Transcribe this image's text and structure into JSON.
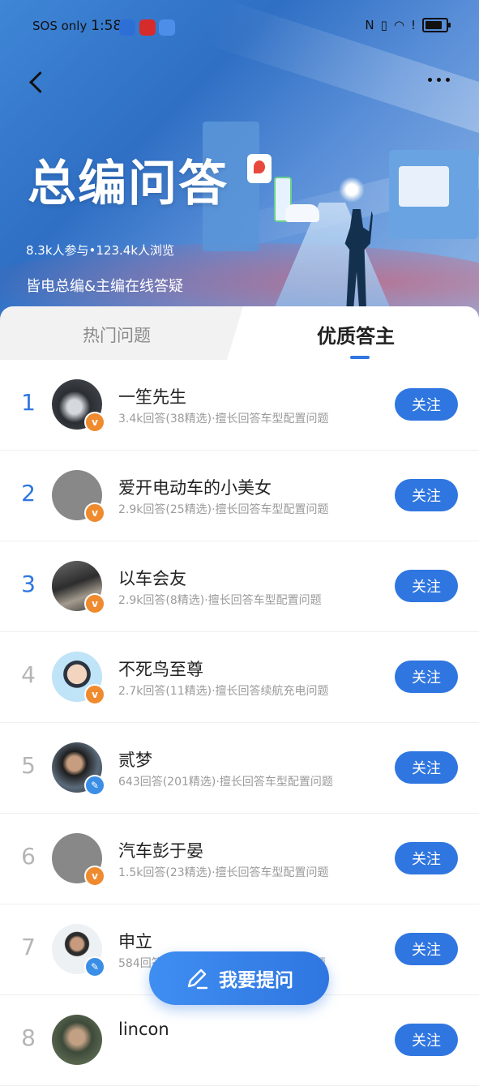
{
  "status_bar": {
    "carrier": "SOS only",
    "time": "1:58"
  },
  "hero": {
    "title": "总编问答",
    "stats": "8.3k人参与•123.4k人浏览",
    "subtitle": "皆电总编&主编在线答疑"
  },
  "tabs": [
    {
      "label": "热门问题",
      "active": false
    },
    {
      "label": "优质答主",
      "active": true
    }
  ],
  "experts": [
    {
      "rank": "1",
      "name": "一笙先生",
      "meta": "3.4k回答(38精选)·擅长回答车型配置问题",
      "badge": "v",
      "follow_label": "关注"
    },
    {
      "rank": "2",
      "name": "爱开电动车的小美女",
      "meta": "2.9k回答(25精选)·擅长回答车型配置问题",
      "badge": "v",
      "follow_label": "关注"
    },
    {
      "rank": "3",
      "name": "以车会友",
      "meta": "2.9k回答(8精选)·擅长回答车型配置问题",
      "badge": "v",
      "follow_label": "关注"
    },
    {
      "rank": "4",
      "name": "不死鸟至尊",
      "meta": "2.7k回答(11精选)·擅长回答续航充电问题",
      "badge": "v",
      "follow_label": "关注"
    },
    {
      "rank": "5",
      "name": "贰梦",
      "meta": "643回答(201精选)·擅长回答车型配置问题",
      "badge": "p",
      "follow_label": "关注"
    },
    {
      "rank": "6",
      "name": "汽车彭于晏",
      "meta": "1.5k回答(23精选)·擅长回答车型配置问题",
      "badge": "v",
      "follow_label": "关注"
    },
    {
      "rank": "7",
      "name": "申立",
      "meta": "584回答(96精选)·擅长回答车型配置问题",
      "badge": "p",
      "follow_label": "关注"
    },
    {
      "rank": "8",
      "name": "lincon",
      "meta": "",
      "badge": "v",
      "follow_label": "关注"
    }
  ],
  "ask_button": {
    "label": "我要提问"
  },
  "colors": {
    "accent": "#2f76e0",
    "badge_v": "#ef8a2e",
    "badge_p": "#3a8ee6"
  }
}
